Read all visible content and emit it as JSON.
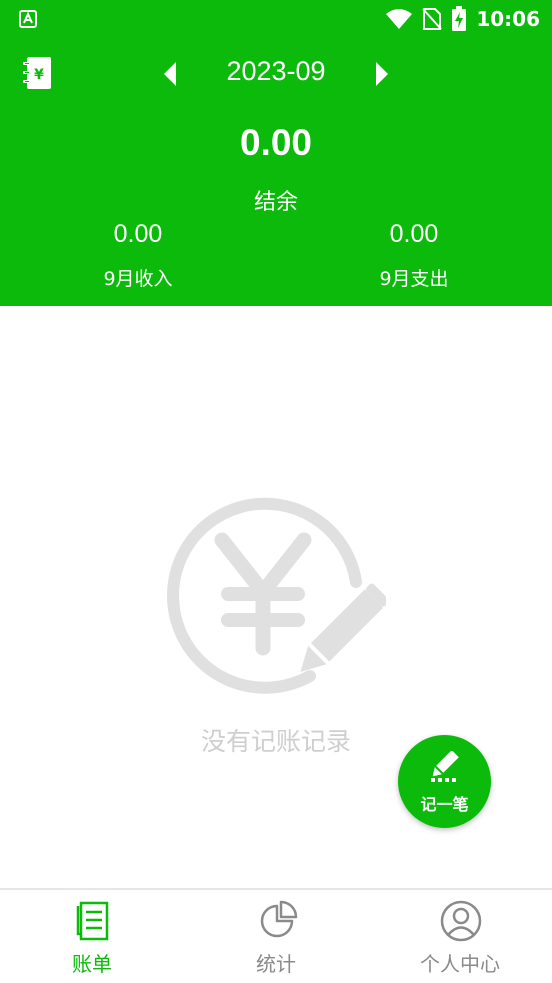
{
  "status_bar": {
    "time": "10:06",
    "app_icon": "a-icon",
    "icons": [
      "wifi-icon",
      "no-sim-icon",
      "battery-charging-icon"
    ]
  },
  "header": {
    "month": "2023-09",
    "balance_value": "0.00",
    "balance_label": "结余",
    "income_value": "0.00",
    "income_label": "9月收入",
    "expense_value": "0.00",
    "expense_label": "9月支出"
  },
  "empty_state": {
    "message": "没有记账记录",
    "icon": "yen-pencil-icon"
  },
  "fab": {
    "label": "记一笔",
    "icon": "pencil-icon"
  },
  "bottom_nav": {
    "items": [
      {
        "label": "账单",
        "icon": "bill-icon",
        "active": true
      },
      {
        "label": "统计",
        "icon": "pie-chart-icon",
        "active": false
      },
      {
        "label": "个人中心",
        "icon": "user-icon",
        "active": false
      }
    ]
  },
  "colors": {
    "primary": "#0bba0b",
    "empty_gray": "#e0e0e0",
    "nav_inactive": "#8a8a8a"
  }
}
